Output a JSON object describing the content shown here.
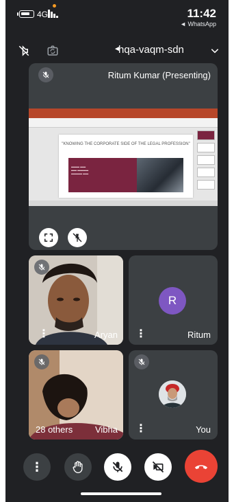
{
  "status_bar": {
    "time": "11:42",
    "back_app": "◄ WhatsApp",
    "network": "4G"
  },
  "top_bar": {
    "meeting_code": "hqa-vaqm-sdn"
  },
  "presenter_tile": {
    "label": "Ritum Kumar (Presenting)",
    "slide_title": "\"KNOWING THE CORPORATE SIDE OF THE LEGAL PROFESSION\""
  },
  "participants": [
    {
      "name": "Aryan",
      "kind": "video"
    },
    {
      "name": "Ritum",
      "kind": "avatar",
      "initial": "R"
    },
    {
      "name": "Vibha",
      "kind": "video",
      "extra": "28 others"
    },
    {
      "name": "You",
      "kind": "photo"
    }
  ],
  "colors": {
    "background": "#202124",
    "tile": "#3c4043",
    "avatar_purple": "#7e57c2",
    "end_call_red": "#ea4335"
  },
  "icons": {
    "more": "more-vertical-icon",
    "hand": "raise-hand-icon",
    "mic": "mic-off-icon",
    "camera": "camera-off-icon",
    "end": "end-call-icon"
  }
}
